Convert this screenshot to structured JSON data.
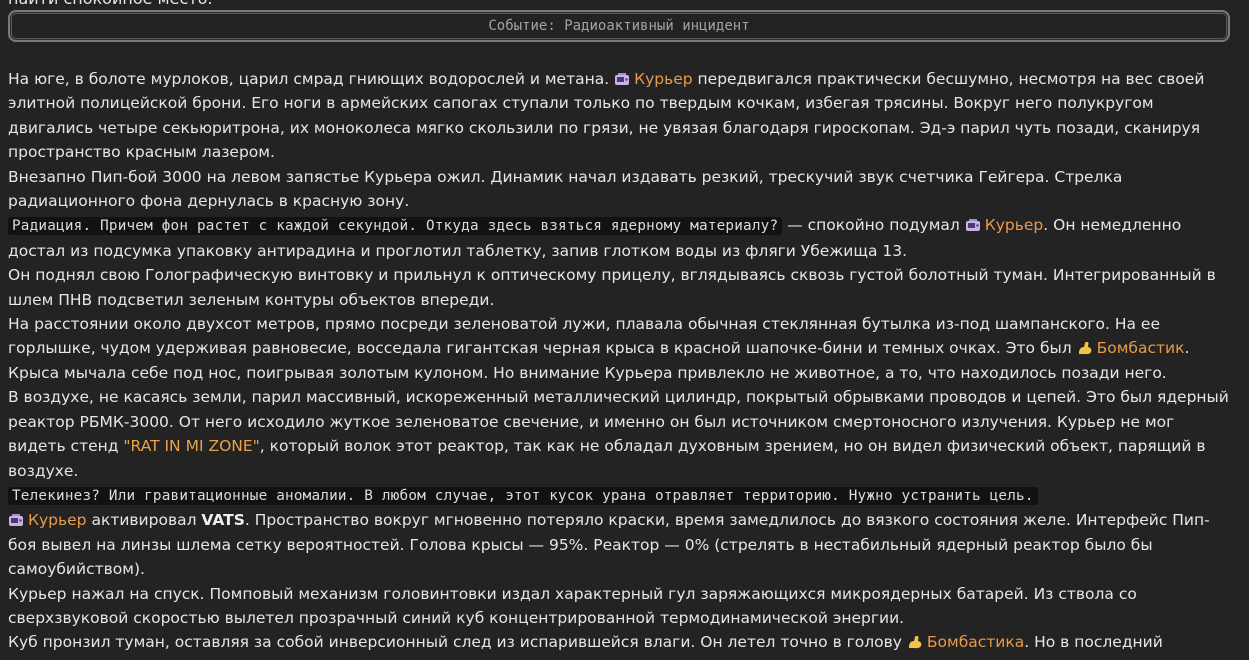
{
  "cutoff": "найти спокойное место.",
  "event_title": "Событие: Радиоактивный инцидент",
  "colors": {
    "background": "#232323",
    "text": "#e6e6e6",
    "character": "#e8a24a",
    "thought_bg": "#121212"
  },
  "icons": {
    "courier": "pip-boy-icon",
    "bombastic": "flexed-arm-icon"
  },
  "story": {
    "p1": {
      "a": "На юге, в болоте мурлоков, царил смрад гниющих водорослей и метана. ",
      "name": "Курьер",
      "b": " передвигался практически бесшумно, несмотря на вес своей элитной полицейской брони. Его ноги в армейских сапогах ступали только по твердым кочкам, избегая трясины. Вокруг него полукругом двигались четыре секьюритрона, их моноколеса мягко скользили по грязи, не увязая благодаря гироскопам. Эд-э парил чуть позади, сканируя пространство красным лазером."
    },
    "p2": "Внезапно Пип-бой 3000 на левом запястье Курьера ожил. Динамик начал издавать резкий, трескучий звук счетчика Гейгера. Стрелка радиационного фона дернулась в красную зону.",
    "p3": {
      "thought": "Радиация. Причем фон растет с каждой секундой. Откуда здесь взяться ядерному материалу?",
      "a": " — спокойно подумал ",
      "name": "Курьер",
      "b": ". Он немедленно достал из подсумка упаковку антирадина и проглотил таблетку, запив глотком воды из фляги Убежища 13."
    },
    "p4": "Он поднял свою Голографическую винтовку и прильнул к оптическому прицелу, вглядываясь сквозь густой болотный туман. Интегрированный в шлем ПНВ подсветил зеленым контуры объектов впереди.",
    "p5": {
      "a": "На расстоянии около двухсот метров, прямо посреди зеленоватой лужи, плавала обычная стеклянная бутылка из-под шампанского. На ее горлышке, чудом удерживая равновесие, восседала гигантская черная крыса в красной шапочке-бини и темных очках. Это был ",
      "name": "Бомбастик",
      "b": "."
    },
    "p6": "Крыса мычала себе под нос, поигрывая золотым кулоном. Но внимание Курьера привлекло не животное, а то, что находилось позади него.",
    "p7": {
      "a": "В воздухе, не касаясь земли, парил массивный, искореженный металлический цилиндр, покрытый обрывками проводов и цепей. Это был ядерный реактор РБМК-3000. От него исходило жуткое зеленоватое свечение, и именно он был источником смертоносного излучения. Курьер не мог видеть стенд ",
      "quote": "\"RAT IN MI ZONE\"",
      "b": ", который волок этот реактор, так как не обладал духовным зрением, но он видел физический объект, парящий в воздухе."
    },
    "p8": {
      "thought": "Телекинез? Или гравитационные аномалии. В любом случае, этот кусок урана отравляет территорию. Нужно устранить цель."
    },
    "p9": {
      "name": "Курьер",
      "a": " активировал ",
      "bold": "VATS",
      "b": ". Пространство вокруг мгновенно потеряло краски, время замедлилось до вязкого состояния желе. Интерфейс Пип-боя вывел на линзы шлема сетку вероятностей. Голова крысы — 95%. Реактор — 0% (стрелять в нестабильный ядерный реактор было бы самоубийством)."
    },
    "p10": "Курьер нажал на спуск. Помповый механизм головинтовки издал характерный гул заряжающихся микроядерных батарей. Из ствола со сверхзвуковой скоростью вылетел прозрачный синий куб концентрированной термодинамической энергии.",
    "p11": {
      "a": "Куб пронзил туман, оставляя за собой инверсионный след из испарившейся влаги. Он летел точно в голову ",
      "name": "Бомбастика",
      "b": ". Но в последний"
    }
  }
}
